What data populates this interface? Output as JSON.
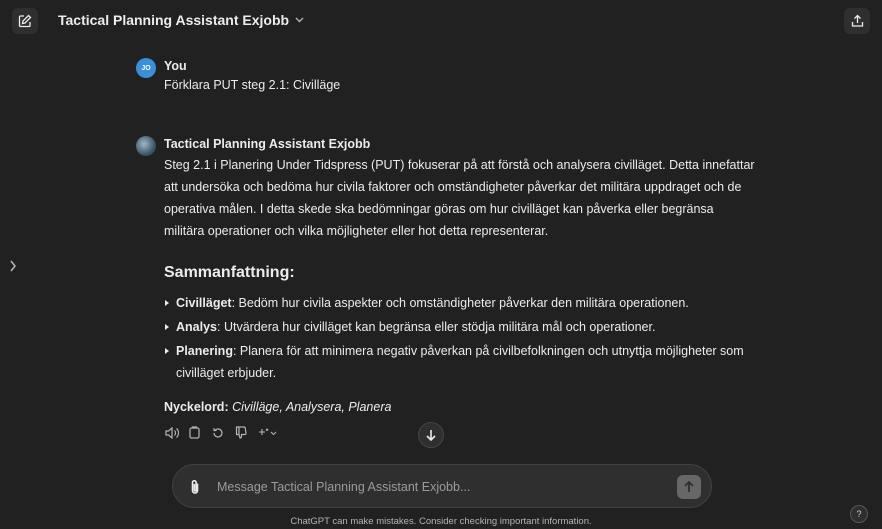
{
  "header": {
    "title": "Tactical Planning Assistant Exjobb"
  },
  "conversation": {
    "user_message": {
      "author": "You",
      "avatar_initials": "JO",
      "text": "Förklara PUT steg 2.1: Civilläge"
    },
    "assistant_message": {
      "author": "Tactical Planning Assistant Exjobb",
      "paragraph": "Steg 2.1 i Planering Under Tidspress (PUT) fokuserar på att förstå och analysera civilläget. Detta innefattar att undersöka och bedöma hur civila faktorer och omständigheter påverkar det militära uppdraget och de operativa målen. I detta skede ska bedömningar göras om hur civilläget kan påverka eller begränsa militära operationer och vilka möjligheter eller hot detta representerar.",
      "summary_heading": "Sammanfattning:",
      "bullets": [
        {
          "term": "Civilläget",
          "text": ": Bedöm hur civila aspekter och omständigheter påverkar den militära operationen."
        },
        {
          "term": "Analys",
          "text": ": Utvärdera hur civilläget kan begränsa eller stödja militära mål och operationer."
        },
        {
          "term": "Planering",
          "text": ": Planera för att minimera negativ påverkan på civilbefolkningen och utnyttja möjligheter som civilläget erbjuder."
        }
      ],
      "keywords_label": "Nyckelord:",
      "keywords_value": "Civilläge, Analysera, Planera"
    }
  },
  "composer": {
    "placeholder": "Message Tactical Planning Assistant Exjobb..."
  },
  "footer": {
    "disclaimer": "ChatGPT can make mistakes. Consider checking important information.",
    "help_label": "?"
  },
  "icons": {
    "edit": "edit-icon",
    "chevron": "chevron-down-icon",
    "share": "share-icon",
    "sidebar_toggle": "chevron-right-icon",
    "read_aloud": "speaker-icon",
    "copy": "copy-icon",
    "regenerate": "regenerate-icon",
    "thumbs_down": "thumbs-down-icon",
    "model_switch": "sparkle-icon",
    "scroll_down": "arrow-down-icon",
    "attach": "paperclip-icon",
    "send": "arrow-up-icon"
  }
}
